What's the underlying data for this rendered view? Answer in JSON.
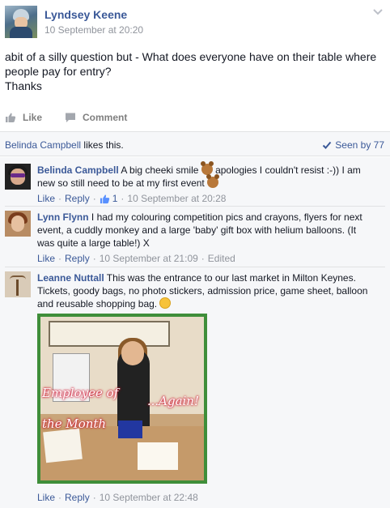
{
  "post": {
    "author": "Lyndsey Keene",
    "time": "10 September at 20:20",
    "text_line1": "abit of a silly question but - What does everyone have on their table where",
    "text_line2": "people pay for entry?",
    "text_line3": "Thanks"
  },
  "actions": {
    "like": "Like",
    "comment": "Comment"
  },
  "likes": {
    "liker": "Belinda Campbell",
    "suffix": " likes this.",
    "seen": "Seen by 77"
  },
  "comments": [
    {
      "name": "Belinda Campbell",
      "line1_a": " A big cheeki smile ",
      "line1_b": " apologies I couldn't resist :-)) I am",
      "line2": "new so still need to be at my first event",
      "like": "Like",
      "reply": "Reply",
      "like_count": "1",
      "time": "10 September at 20:28"
    },
    {
      "name": "Lynn Flynn",
      "line1": " I had my colouring competition pics and crayons, flyers for next",
      "line2": "event, a cuddly monkey and a large 'baby' gift box with helium balloons. (It",
      "line3": "was quite a large table!) X",
      "like": "Like",
      "reply": "Reply",
      "time": "10 September at 21:09",
      "edited": "Edited"
    },
    {
      "name": "Leanne Nuttall",
      "line1": " This was the entrance to our last market in Milton Keynes.",
      "line2": "Tickets, goody bags, no photo stickers, admission price, game sheet, balloon",
      "line3": "and reusable shopping bag. ",
      "photo_text_left1": "Employee of",
      "photo_text_left2": "the Month",
      "photo_text_right": "...Again!",
      "like": "Like",
      "reply": "Reply",
      "time": "10 September at 22:48"
    }
  ],
  "colors": {
    "link": "#3b5998",
    "meta": "#90949c",
    "photo_border": "#3f8e3a"
  }
}
